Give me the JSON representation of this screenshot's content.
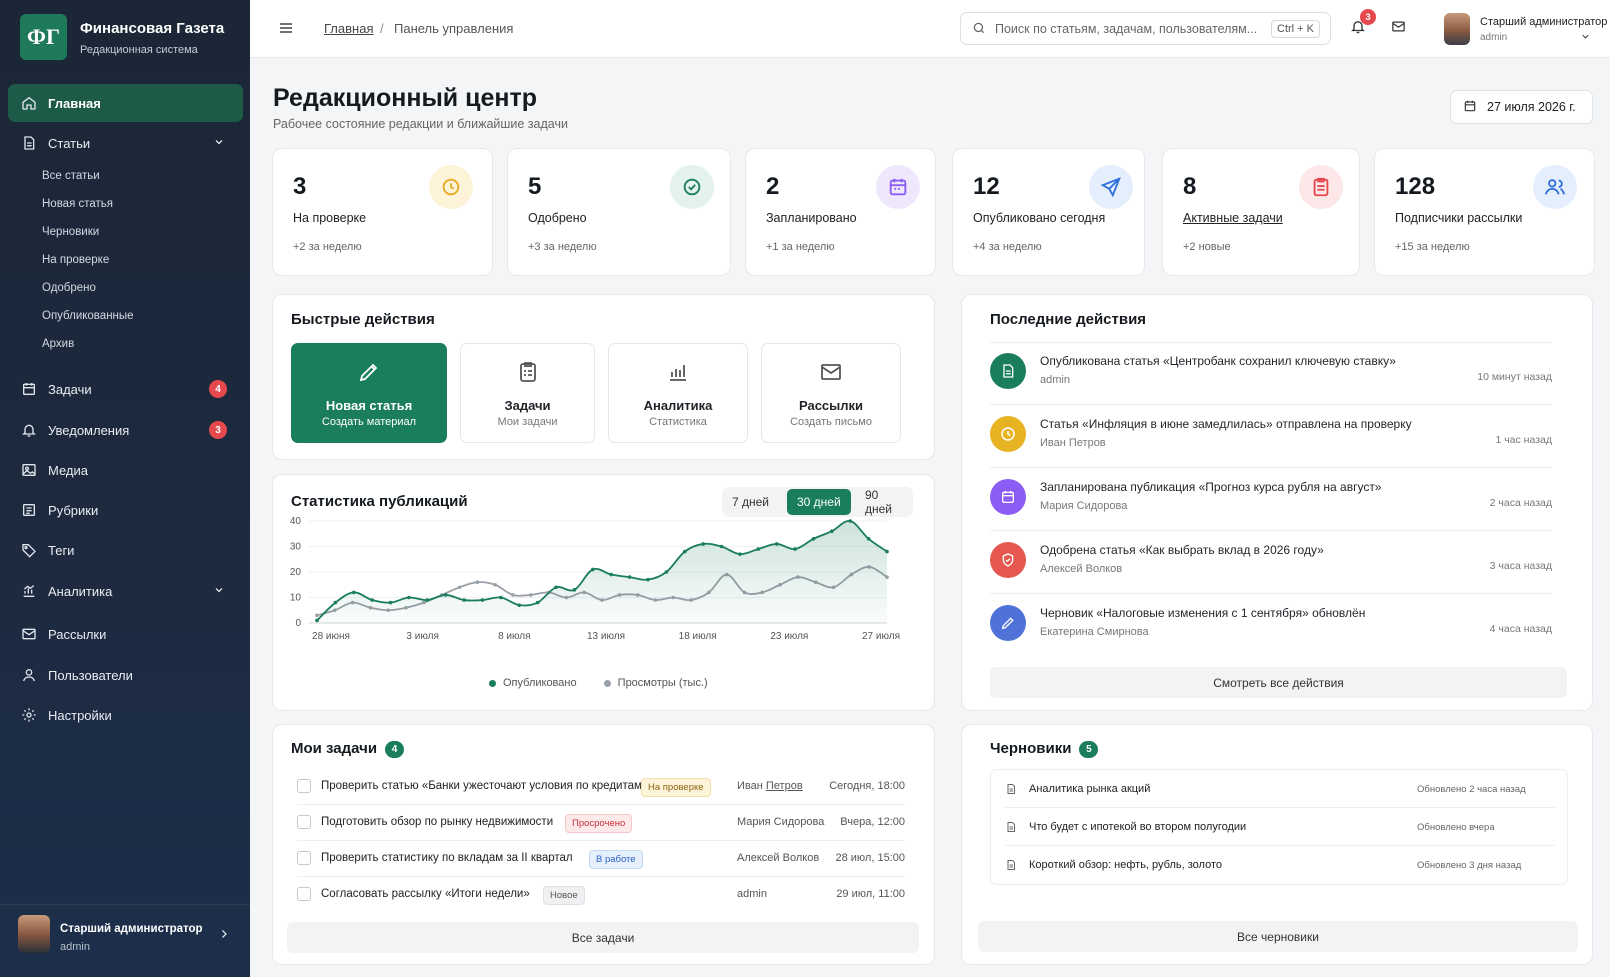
{
  "brand": {
    "logo": "ФГ",
    "title": "Финансовая Газета",
    "subtitle": "Редакционная система"
  },
  "nav": {
    "home": "Главная",
    "articles": "Статьи",
    "articles_sub": [
      "Все статьи",
      "Новая статья",
      "Черновики",
      "На проверке",
      "Одобрено",
      "Опубликованные",
      "Архив"
    ],
    "tasks": "Задачи",
    "tasks_badge": "4",
    "notifications": "Уведомления",
    "notifications_badge": "3",
    "media": "Медиа",
    "rubrics": "Рубрики",
    "tags": "Теги",
    "analytics": "Аналитика",
    "mailings": "Рассылки",
    "users": "Пользователи",
    "settings": "Настройки"
  },
  "sidebar_user": {
    "name": "Старший администратор",
    "role": "admin"
  },
  "topbar": {
    "breadcrumb_home": "Главная",
    "breadcrumb_sep": "/",
    "breadcrumb_current": "Панель управления",
    "search_placeholder": "Поиск по статьям, задачам, пользователям...",
    "search_shortcut": "Ctrl + K",
    "notif_count": "3",
    "user_name": "Старший администратор",
    "user_role": "admin"
  },
  "page": {
    "title": "Редакционный центр",
    "subtitle": "Рабочее состояние редакции и ближайшие задачи",
    "date": "27 июля 2026 г."
  },
  "stats": [
    {
      "value": "3",
      "label": "На проверке",
      "delta": "+2 за неделю",
      "color": "#e8a923",
      "icon": "clock-icon"
    },
    {
      "value": "5",
      "label": "Одобрено",
      "delta": "+3 за неделю",
      "color": "#1a7d5d",
      "icon": "check-circle-icon"
    },
    {
      "value": "2",
      "label": "Запланировано",
      "delta": "+1 за неделю",
      "color": "#8b5cf6",
      "icon": "calendar-icon"
    },
    {
      "value": "12",
      "label": "Опубликовано сегодня",
      "delta": "+4 за неделю",
      "color": "#2f6fdb",
      "icon": "send-icon"
    },
    {
      "value": "8",
      "label": "Активные задачи",
      "delta": "+2 новые",
      "color": "#e5484d",
      "icon": "clipboard-icon"
    },
    {
      "value": "128",
      "label": "Подписчики рассылки",
      "delta": "+15 за неделю",
      "color": "#2f6fdb",
      "icon": "users-icon"
    }
  ],
  "quick": {
    "title": "Быстрые действия",
    "items": [
      {
        "title": "Новая статья",
        "sub": "Создать материал",
        "icon": "pencil-icon"
      },
      {
        "title": "Задачи",
        "sub": "Мои задачи",
        "icon": "clipboard-icon"
      },
      {
        "title": "Аналитика",
        "sub": "Статистика",
        "icon": "bar-chart-icon"
      },
      {
        "title": "Рассылки",
        "sub": "Создать письмо",
        "icon": "mail-icon"
      }
    ]
  },
  "chart_data": {
    "type": "area",
    "title": "Статистика публикаций",
    "ranges": [
      "7 дней",
      "30 дней",
      "90 дней"
    ],
    "active_range": "30 дней",
    "x_ticks": [
      "28 июня",
      "3 июля",
      "8 июля",
      "13 июля",
      "18 июля",
      "23 июля",
      "27 июля"
    ],
    "ylim": [
      0,
      40
    ],
    "y_ticks": [
      0,
      10,
      20,
      30,
      40
    ],
    "grid": true,
    "legend_position": "bottom",
    "series": [
      {
        "name": "Опубликовано",
        "color": "#1a7d5d",
        "fill": true,
        "values": [
          1,
          8,
          12,
          9,
          8,
          10,
          9,
          11,
          9,
          9,
          10,
          7,
          8,
          14,
          13,
          21,
          19,
          18,
          17,
          20,
          28,
          31,
          30,
          27,
          29,
          31,
          29,
          33,
          36,
          40,
          33,
          28
        ]
      },
      {
        "name": "Просмотры (тыс.)",
        "color": "#9aa0a8",
        "fill": false,
        "values": [
          3,
          5,
          8,
          6,
          5,
          6,
          8,
          11,
          14,
          16,
          15,
          11,
          11,
          12,
          10,
          12,
          9,
          11,
          11,
          9,
          10,
          9,
          12,
          19,
          12,
          12,
          15,
          18,
          16,
          14,
          19,
          22,
          18
        ]
      }
    ]
  },
  "activity": {
    "title": "Последние действия",
    "items": [
      {
        "text": "Опубликована статья «Центробанк сохранил ключевую ставку»",
        "user": "admin",
        "time": "10 минут назад",
        "color": "#1a7d5d",
        "icon": "document-icon"
      },
      {
        "text": "Статья «Инфляция в июне замедлилась» отправлена на проверку",
        "user": "Иван Петров",
        "time": "1 час назад",
        "color": "#e8b323",
        "icon": "clock-icon"
      },
      {
        "text": "Запланирована публикация «Прогноз курса рубля на август»",
        "user": "Мария Сидорова",
        "time": "2 часа назад",
        "color": "#8b5cf6",
        "icon": "calendar-icon"
      },
      {
        "text": "Одобрена статья «Как выбрать вклад в 2026 году»",
        "user": "Алексей Волков",
        "time": "3 часа назад",
        "color": "#e5574f",
        "icon": "approve-icon"
      },
      {
        "text": "Черновик «Налоговые изменения с 1 сентября» обновлён",
        "user": "Екатерина Смирнова",
        "time": "4 часа назад",
        "color": "#4f72d9",
        "icon": "edit-icon"
      }
    ],
    "all_label": "Смотреть все действия"
  },
  "tasks": {
    "title": "Мои задачи",
    "count": "4",
    "items": [
      {
        "title": "Проверить статью «Банки ужесточают условия по кредитам»",
        "tag": "На проверке",
        "tag_type": "review",
        "assignee_first": "Иван",
        "assignee_last": "Петров",
        "due": "Сегодня, 18:00"
      },
      {
        "title": "Подготовить обзор по рынку недвижимости",
        "tag": "Просрочено",
        "tag_type": "overdue",
        "assignee": "Мария Сидорова",
        "due": "Вчера, 12:00"
      },
      {
        "title": "Проверить статистику по вкладам за II квартал",
        "tag": "В работе",
        "tag_type": "work",
        "assignee": "Алексей Волков",
        "due": "28 июл, 15:00"
      },
      {
        "title": "Согласовать рассылку «Итоги недели»",
        "tag": "Новое",
        "tag_type": "new",
        "assignee": "admin",
        "due": "29 июл, 11:00"
      }
    ],
    "all_label": "Все задачи"
  },
  "drafts": {
    "title": "Черновики",
    "count": "5",
    "items": [
      {
        "title": "Аналитика рынка акций",
        "updated": "Обновлено 2 часа назад"
      },
      {
        "title": "Что будет с ипотекой во втором полугодии",
        "updated": "Обновлено вчера"
      },
      {
        "title": "Короткий обзор: нефть, рубль, золото",
        "updated": "Обновлено 3 дня назад"
      }
    ],
    "all_label": "Все черновики"
  }
}
